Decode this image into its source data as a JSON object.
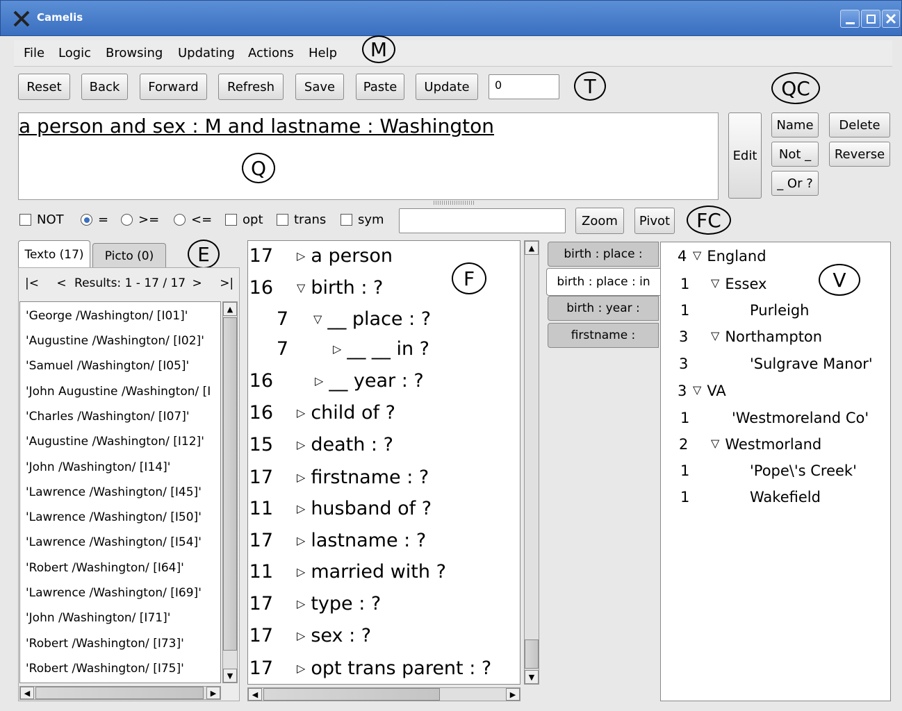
{
  "window": {
    "title": "Camelis"
  },
  "menu": [
    "File",
    "Logic",
    "Browsing",
    "Updating",
    "Actions",
    "Help"
  ],
  "toolbar": {
    "buttons": [
      "Reset",
      "Back",
      "Forward",
      "Refresh",
      "Save",
      "Paste",
      "Update"
    ],
    "counter_value": "0"
  },
  "query": {
    "text": "a person and sex : M and lastname : Washington"
  },
  "query_controls": {
    "edit": "Edit",
    "name": "Name",
    "delete": "Delete",
    "not": "Not _",
    "reverse": "Reverse",
    "or": "_ Or ?"
  },
  "feature_controls": {
    "not_label": "NOT",
    "eq_label": "=",
    "ge_label": ">=",
    "le_label": "<=",
    "opt_label": "opt",
    "trans_label": "trans",
    "sym_label": "sym",
    "filter_value": "",
    "zoom": "Zoom",
    "pivot": "Pivot"
  },
  "annotations": {
    "M": "M",
    "T": "T",
    "QC": "QC",
    "Q": "Q",
    "FC": "FC",
    "E": "E",
    "F": "F",
    "V": "V"
  },
  "extent": {
    "tabs": [
      "Texto (17)",
      "Picto (0)"
    ],
    "nav": {
      "first": "|<",
      "prev": "<",
      "range": "Results: 1 - 17 / 17",
      "next": ">",
      "last": ">|"
    },
    "items": [
      "'George /Washington/ [I01]'",
      "'Augustine /Washington/ [I02]'",
      "'Samuel /Washington/ [I05]'",
      "'John Augustine /Washington/ [I",
      "'Charles /Washington/ [I07]'",
      "'Augustine /Washington/ [I12]'",
      "'John /Washington/ [I14]'",
      "'Lawrence /Washington/ [I45]'",
      "'Lawrence /Washington/ [I50]'",
      "'Lawrence /Washington/ [I54]'",
      "'Robert /Washington/ [I64]'",
      "'Lawrence /Washington/ [I69]'",
      "'John /Washington/ [I71]'",
      "'Robert /Washington/ [I73]'",
      "'Robert /Washington/ [I75]'"
    ]
  },
  "features": [
    {
      "count": "17",
      "toggle": "closed",
      "label": "a person",
      "depth": 0
    },
    {
      "count": "16",
      "toggle": "open",
      "label": "birth : ?",
      "depth": 0
    },
    {
      "count": "7",
      "toggle": "open",
      "label": "__ place : ?",
      "depth": 1
    },
    {
      "count": "7",
      "toggle": "closed",
      "label": "__ __ in ?",
      "depth": 2
    },
    {
      "count": "16",
      "toggle": "closed",
      "label": "__ year : ?",
      "depth": 1
    },
    {
      "count": "16",
      "toggle": "closed",
      "label": "child of ?",
      "depth": 0
    },
    {
      "count": "15",
      "toggle": "closed",
      "label": "death : ?",
      "depth": 0
    },
    {
      "count": "17",
      "toggle": "closed",
      "label": "firstname : ?",
      "depth": 0
    },
    {
      "count": "11",
      "toggle": "closed",
      "label": "husband of ?",
      "depth": 0
    },
    {
      "count": "17",
      "toggle": "closed",
      "label": "lastname : ?",
      "depth": 0
    },
    {
      "count": "11",
      "toggle": "closed",
      "label": "married with ?",
      "depth": 0
    },
    {
      "count": "17",
      "toggle": "closed",
      "label": "type : ?",
      "depth": 0
    },
    {
      "count": "17",
      "toggle": "closed",
      "label": "sex : ?",
      "depth": 0
    },
    {
      "count": "17",
      "toggle": "closed",
      "label": "opt trans parent : ?",
      "depth": 0
    }
  ],
  "value_tabs": [
    "birth : place :",
    "birth : place : in",
    "birth : year :",
    "firstname :"
  ],
  "values": [
    {
      "count": "4",
      "toggle": "open",
      "label": "England",
      "depth": 0
    },
    {
      "count": "1",
      "toggle": "open",
      "label": "Essex",
      "depth": 1
    },
    {
      "count": "1",
      "toggle": "",
      "label": "Purleigh",
      "depth": 2
    },
    {
      "count": "3",
      "toggle": "open",
      "label": "Northampton",
      "depth": 1
    },
    {
      "count": "3",
      "toggle": "",
      "label": "'Sulgrave Manor'",
      "depth": 2
    },
    {
      "count": "3",
      "toggle": "open",
      "label": "VA",
      "depth": 0
    },
    {
      "count": "1",
      "toggle": "",
      "label": "'Westmoreland Co'",
      "depth": 1
    },
    {
      "count": "2",
      "toggle": "open",
      "label": "Westmorland",
      "depth": 1
    },
    {
      "count": "1",
      "toggle": "",
      "label": "'Pope\\'s Creek'",
      "depth": 2
    },
    {
      "count": "1",
      "toggle": "",
      "label": "Wakefield",
      "depth": 2
    }
  ]
}
